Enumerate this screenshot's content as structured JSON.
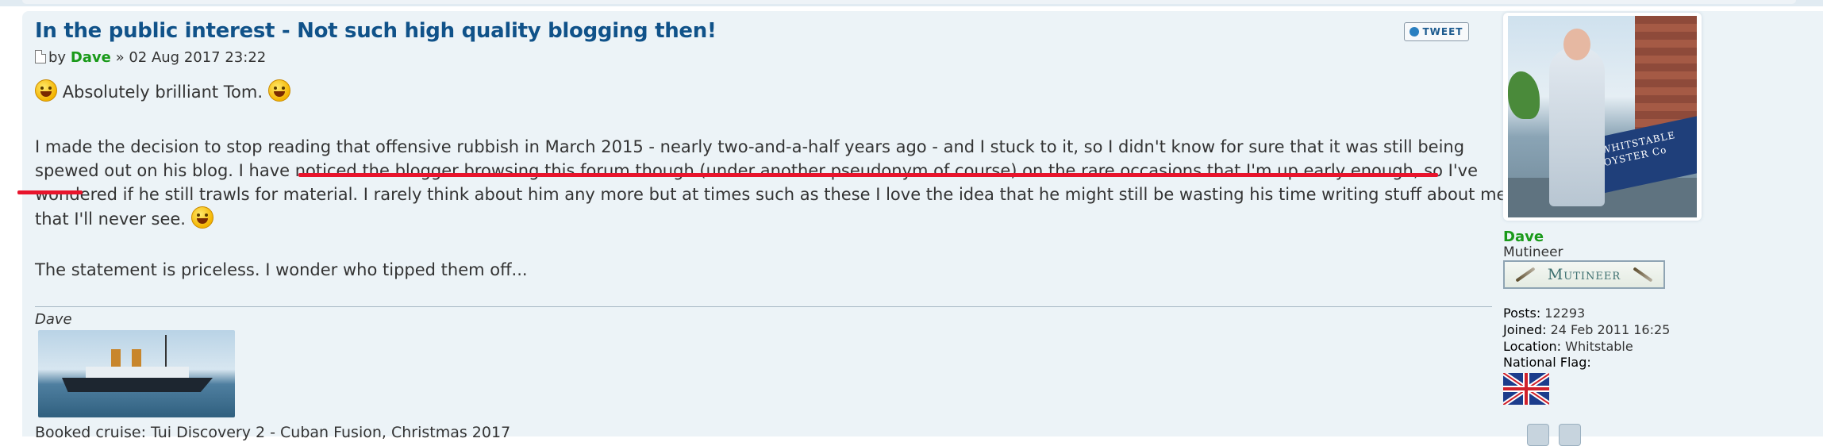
{
  "post": {
    "title": "In the public interest - Not such high quality blogging then!",
    "by_label": "by",
    "author": "Dave",
    "date_sep": "»",
    "date": "02 Aug 2017 23:22",
    "tweet_label": "TWEET"
  },
  "content": {
    "line1": "Absolutely brilliant Tom.",
    "para_part1": "I made the decision to stop reading that offensive rubbish in March 2015 - nearly two-and-a-half years ago - and I stuck to it, so I didn't know for sure that it was still being spewed out on his blog.",
    "para_highlight": "I have noticed the blogger browsing this forum though (under another pseudonym of course) on the rare occasions that I'm up early enough,",
    "para_part2": "so I've wondered if he still trawls for material. I rarely think about him any more but at times such as these I love the idea that he might still be wasting his time writing stuff about me that I'll never see.",
    "statement": "The statement is priceless. I wonder who tipped them off..."
  },
  "signature": {
    "name": "Dave",
    "cruise": "Booked cruise: Tui Discovery 2 - Cuban Fusion, Christmas 2017"
  },
  "profile": {
    "name": "Dave",
    "rank": "Mutineer",
    "rank_badge": "Mutineer",
    "posts_label": "Posts:",
    "posts": "12293",
    "joined_label": "Joined:",
    "joined": "24 Feb 2011 16:25",
    "location_label": "Location:",
    "location": "Whitstable",
    "flag_label": "National Flag:",
    "avatar_sign": "WHITSTABLE OYSTER Co"
  },
  "colors": {
    "title": "#105289",
    "author": "#1a9a1a",
    "highlight_underline": "#e8142c",
    "post_bg": "#ecf3f7"
  }
}
